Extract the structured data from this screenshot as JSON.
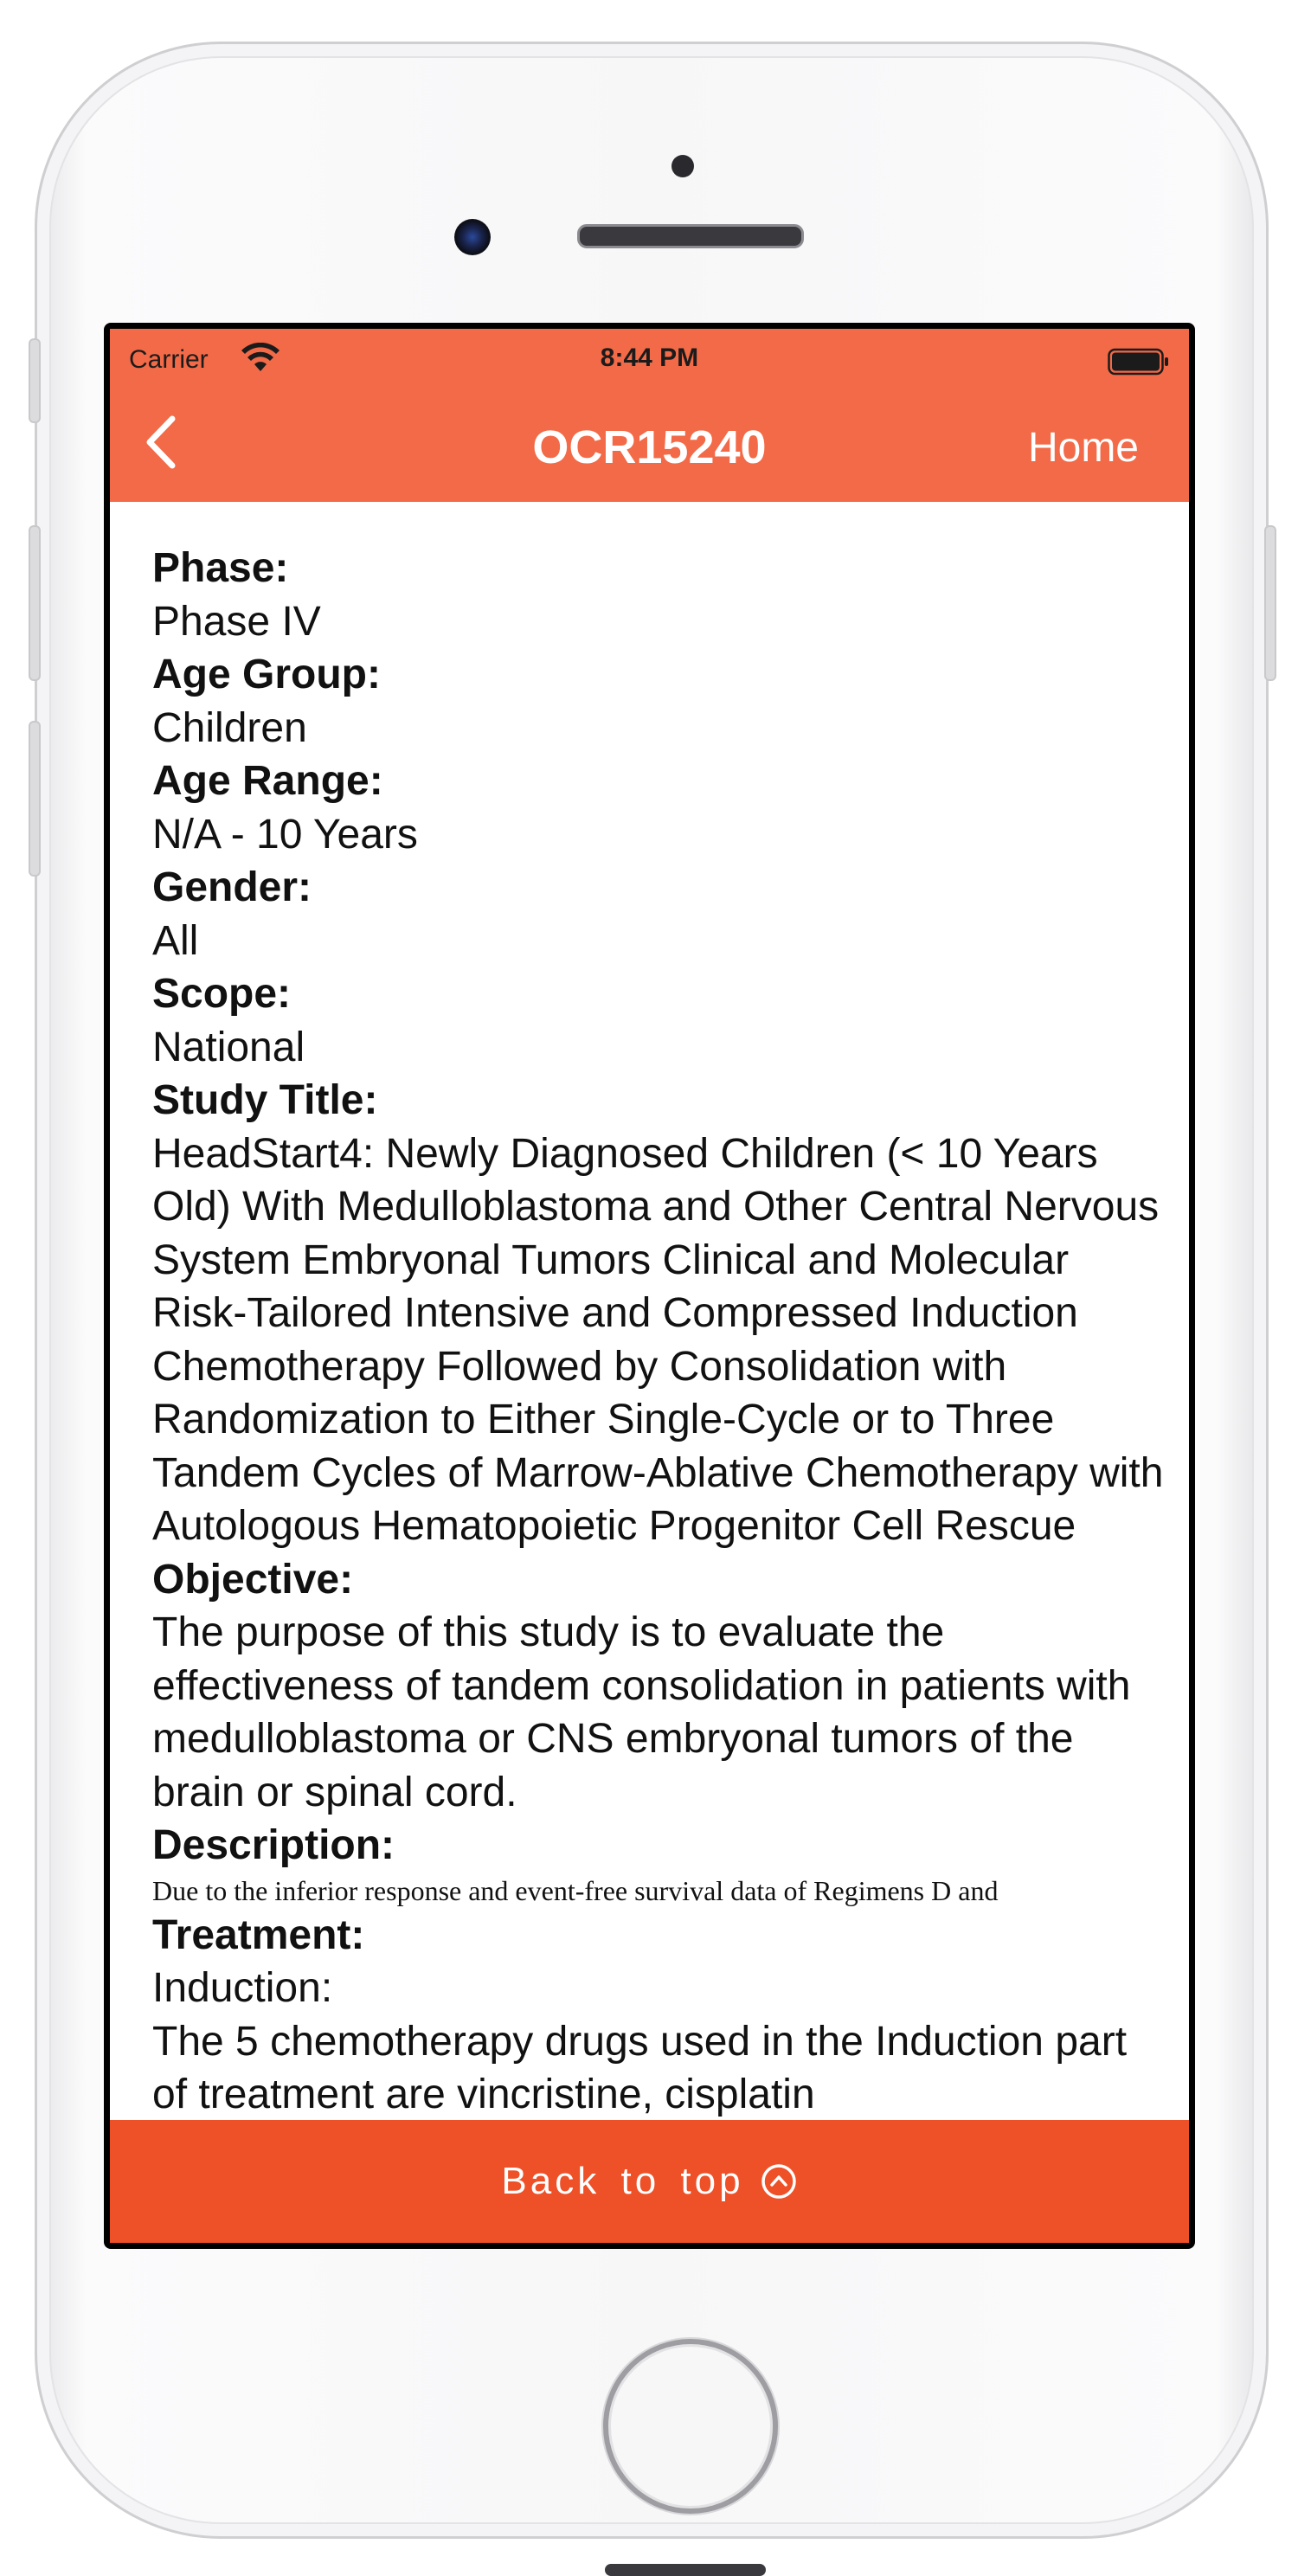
{
  "status_bar": {
    "carrier": "Carrier",
    "time": "8:44 PM"
  },
  "nav": {
    "title": "OCR15240",
    "home_label": "Home"
  },
  "fields": [
    {
      "label": "Phase:",
      "value": "Phase IV"
    },
    {
      "label": "Age Group:",
      "value": "Children"
    },
    {
      "label": "Age Range:",
      "value": "N/A - 10 Years"
    },
    {
      "label": "Gender:",
      "value": "All"
    },
    {
      "label": "Scope:",
      "value": "National"
    },
    {
      "label": "Study Title:",
      "value": "HeadStart4: Newly Diagnosed Children (< 10 Years Old) With Medulloblastoma and Other Central Nervous System Embryonal Tumors Clinical and Molecular Risk-Tailored Intensive and Compressed Induction Chemotherapy Followed by Consolidation with Randomization to Either Single-Cycle or to Three Tandem Cycles of Marrow-Ablative Chemotherapy with Autologous Hematopoietic Progenitor Cell Rescue"
    },
    {
      "label": "Objective:",
      "value": "The purpose of this study is to evaluate the effectiveness of tandem consolidation in patients with medulloblastoma or CNS embryonal tumors of the brain or spinal cord."
    },
    {
      "label": "Description:",
      "value": "Due to the inferior response and event-free survival data of Regimens D and"
    },
    {
      "label": "Treatment:",
      "value": "Induction:"
    }
  ],
  "treatment_continued": "The 5 chemotherapy drugs used in the Induction part of treatment are vincristine, cisplatin",
  "footer": {
    "label": "Back to top"
  },
  "colors": {
    "header": "#f26a47",
    "footer": "#ee5028"
  }
}
